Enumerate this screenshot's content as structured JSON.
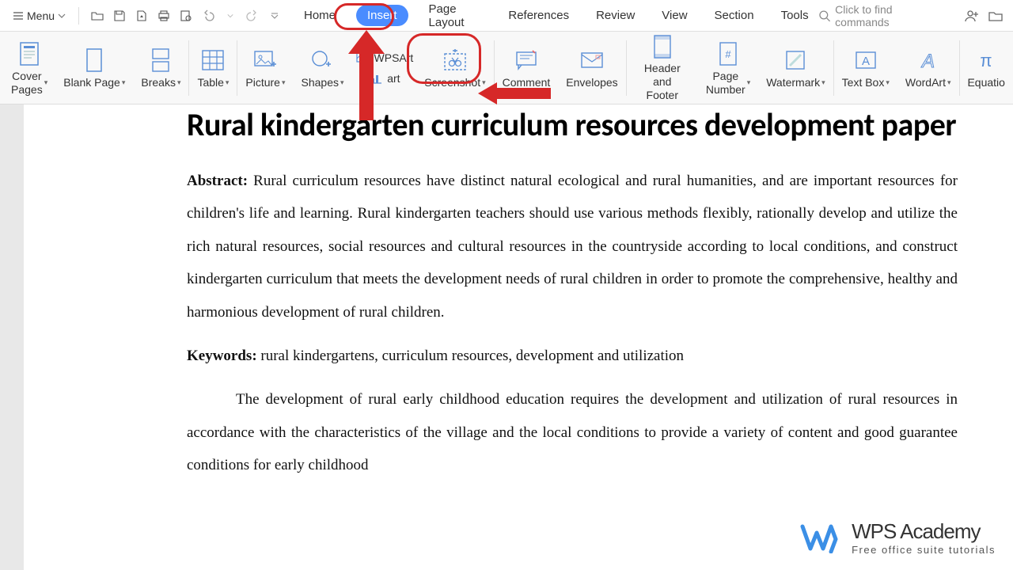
{
  "menu": {
    "label": "Menu"
  },
  "tabs": {
    "home": "Home",
    "insert": "Insert",
    "page_layout": "Page Layout",
    "references": "References",
    "review": "Review",
    "view": "View",
    "section": "Section",
    "tools": "Tools"
  },
  "search": {
    "placeholder": "Click to find commands"
  },
  "ribbon": {
    "cover_pages": "Cover\nPages",
    "blank_page": "Blank Page",
    "breaks": "Breaks",
    "table": "Table",
    "picture": "Picture",
    "shapes": "Shapes",
    "wpsart": "WPSArt",
    "chart": "art",
    "screenshot": "Screenshot",
    "comment": "Comment",
    "envelopes": "Envelopes",
    "header_footer": "Header and\nFooter",
    "page_number": "Page\nNumber",
    "watermark": "Watermark",
    "text_box": "Text Box",
    "wordart": "WordArt",
    "equation": "Equatio"
  },
  "doc": {
    "title": "Rural kindergarten curriculum resources development paper",
    "abstract_label": "Abstract:",
    "abstract": " Rural curriculum resources have distinct natural ecological and rural humanities, and are important resources for children's life and learning. Rural kindergarten teachers should use various methods flexibly, rationally develop and utilize the rich natural resources, social resources and cultural resources in the countryside according to local conditions, and construct kindergarten curriculum that meets the development needs of rural children in order to promote the comprehensive, healthy and harmonious development of rural children.",
    "keywords_label": "Keywords:",
    "keywords": " rural kindergartens, curriculum resources, development and utilization",
    "body1": "The development of rural early childhood education requires the development and utilization of rural resources in accordance with the characteristics of the village and the local conditions to provide a variety of content and good guarantee conditions for early childhood"
  },
  "brand": {
    "main": "WPS Academy",
    "sub": "Free office suite tutorials"
  },
  "annotation": {
    "highlight_tab": "Insert",
    "highlight_button": "Screenshot"
  }
}
